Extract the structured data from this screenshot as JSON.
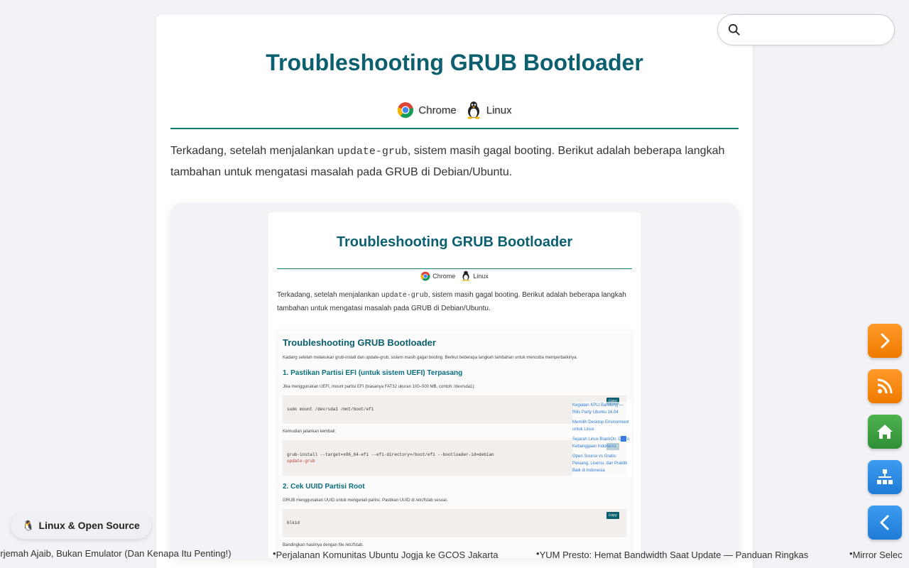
{
  "article": {
    "title": "Troubleshooting GRUB Bootloader",
    "tags": [
      {
        "label": "Chrome",
        "icon": "chrome-icon"
      },
      {
        "label": "Linux",
        "icon": "tux-icon"
      }
    ],
    "intro_prefix": "Terkadang, setelah menjalankan ",
    "intro_code": "update-grub",
    "intro_suffix": ", sistem masih gagal booting. Berikut adalah beberapa langkah tambahan untuk mengatasi masalah pada GRUB di Debian/Ubuntu."
  },
  "preview": {
    "title": "Troubleshooting GRUB Bootloader",
    "tags": [
      "Chrome",
      "Linux"
    ],
    "intro_prefix": "Terkadang, setelah menjalankan ",
    "intro_code": "update-grub",
    "intro_suffix": ", sistem masih gagal booting. Berikut adalah beberapa langkah tambahan untuk mengatasi masalah pada GRUB di Debian/Ubuntu.",
    "inner": {
      "title": "Troubleshooting GRUB Bootloader",
      "intro": "Kadang setelah melakukan grub-install dan update-grub, sistem masih gagal booting. Berikut beberapa langkah tambahan untuk mencoba memperbaikinya.",
      "h1": "1. Pastikan Partisi EFI (untuk sistem UEFI) Terpasang",
      "p1": "Jika menggunakan UEFI, mount partisi EFI (biasanya FAT32 ukuran 100–500 MB, contoh: /dev/sda1):",
      "code1": "sudo mount /dev/sda1 /mnt/boot/efi",
      "p2": "Kemudian jalankan kembali:",
      "code2a": "grub-install --target=x86_64-efi --efi-directory=/boot/efi --bootloader-id=debian",
      "code2b": "update-grub",
      "h2": "2. Cek UUID Partisi Root",
      "p3": "GRUB menggunakan UUID untuk mengenali partisi. Pastikan UUID di /etc/fstab sesuai.",
      "code3": "blkid",
      "p4": "Bandingkan hasilnya dengan file /etc/fstab.",
      "copy": "Copy",
      "links": [
        "Kegiatan KPLI Bandung — Rilis Party Ubuntu 16.04",
        "Memilih Desktop Environment untuk Linux",
        "Sejarah Linux BlankOn: Distro Kebanggaan Indonesia",
        "Open Source vs Gratis: Peluang, Lisensi, dan Praktik Baik di Indonesia"
      ]
    }
  },
  "search": {
    "placeholder": "",
    "value": ""
  },
  "fabs": [
    {
      "icon": "chevron-right-icon",
      "color": "#f68a12"
    },
    {
      "icon": "rss-icon",
      "color": "#f68a12"
    },
    {
      "icon": "home-icon",
      "color": "#3c9f3f"
    },
    {
      "icon": "sitemap-icon",
      "color": "#2b8ae6"
    },
    {
      "icon": "chevron-left-icon",
      "color": "#2b8ae6"
    }
  ],
  "category_pill": {
    "emoji": "🐧",
    "label": "Linux & Open Source"
  },
  "ticker": [
    "Penerjemah Ajaib, Bukan Emulator (Dan Kenapa Itu Penting!)",
    "Perjalanan Komunitas Ubuntu Jogja ke GCOS Jakarta",
    "YUM Presto: Hemat Bandwidth Saat Update — Panduan Ringkas",
    "Mirror Selec"
  ]
}
